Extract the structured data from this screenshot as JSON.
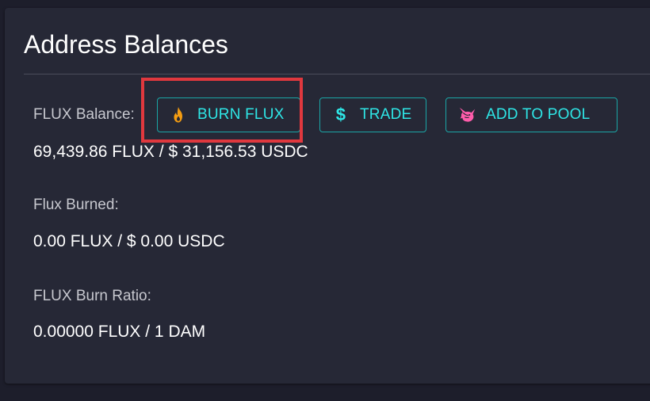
{
  "card": {
    "title": "Address Balances"
  },
  "balances": [
    {
      "label": "FLUX Balance:",
      "value": "69,439.86 FLUX / $ 31,156.53 USDC"
    },
    {
      "label": "Flux Burned:",
      "value": "0.00 FLUX / $ 0.00 USDC"
    },
    {
      "label": "FLUX Burn Ratio:",
      "value": "0.00000 FLUX / 1 DAM"
    }
  ],
  "actions": {
    "burn": {
      "label": "BURN FLUX",
      "icon": "fire-icon"
    },
    "trade": {
      "label": "TRADE",
      "icon": "dollar-icon",
      "glyph": "$"
    },
    "pool": {
      "label": "ADD TO POOL",
      "icon": "unicorn-icon"
    }
  },
  "colors": {
    "page_background": "#1d1e2b",
    "card_background": "#262836",
    "accent": "#2ee6e6",
    "button_border": "#1aa6a6",
    "fire": "#f39c12",
    "unicorn": "#ff5cab",
    "highlight": "#e0383e"
  }
}
